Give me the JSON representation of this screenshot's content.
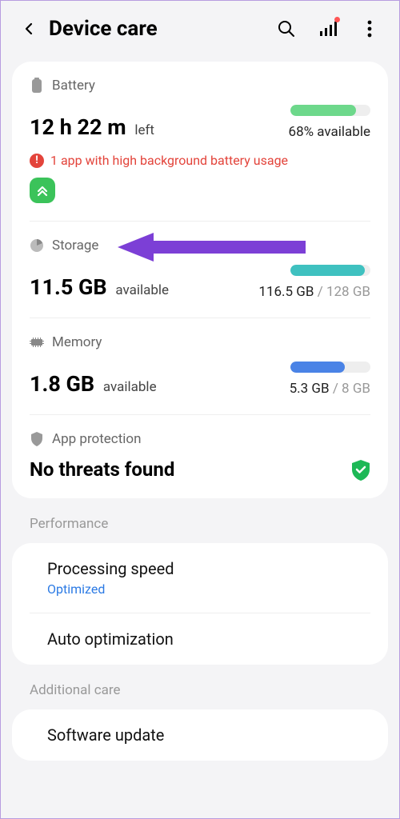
{
  "header": {
    "title": "Device care"
  },
  "battery": {
    "label": "Battery",
    "value": "12 h 22 m",
    "value_suffix": "left",
    "available": "68% available",
    "alert": "1 app with high background battery usage"
  },
  "storage": {
    "label": "Storage",
    "value": "11.5 GB",
    "value_suffix": "available",
    "used": "116.5 GB",
    "total": "128 GB"
  },
  "memory": {
    "label": "Memory",
    "value": "1.8 GB",
    "value_suffix": "available",
    "used": "5.3 GB",
    "total": "8 GB"
  },
  "app_protection": {
    "label": "App protection",
    "status": "No threats found"
  },
  "performance": {
    "group": "Performance",
    "items": {
      "processing_speed": {
        "title": "Processing speed",
        "sub": "Optimized"
      },
      "auto_opt": {
        "title": "Auto optimization"
      }
    }
  },
  "additional": {
    "group": "Additional care",
    "items": {
      "software_update": {
        "title": "Software update"
      }
    }
  }
}
